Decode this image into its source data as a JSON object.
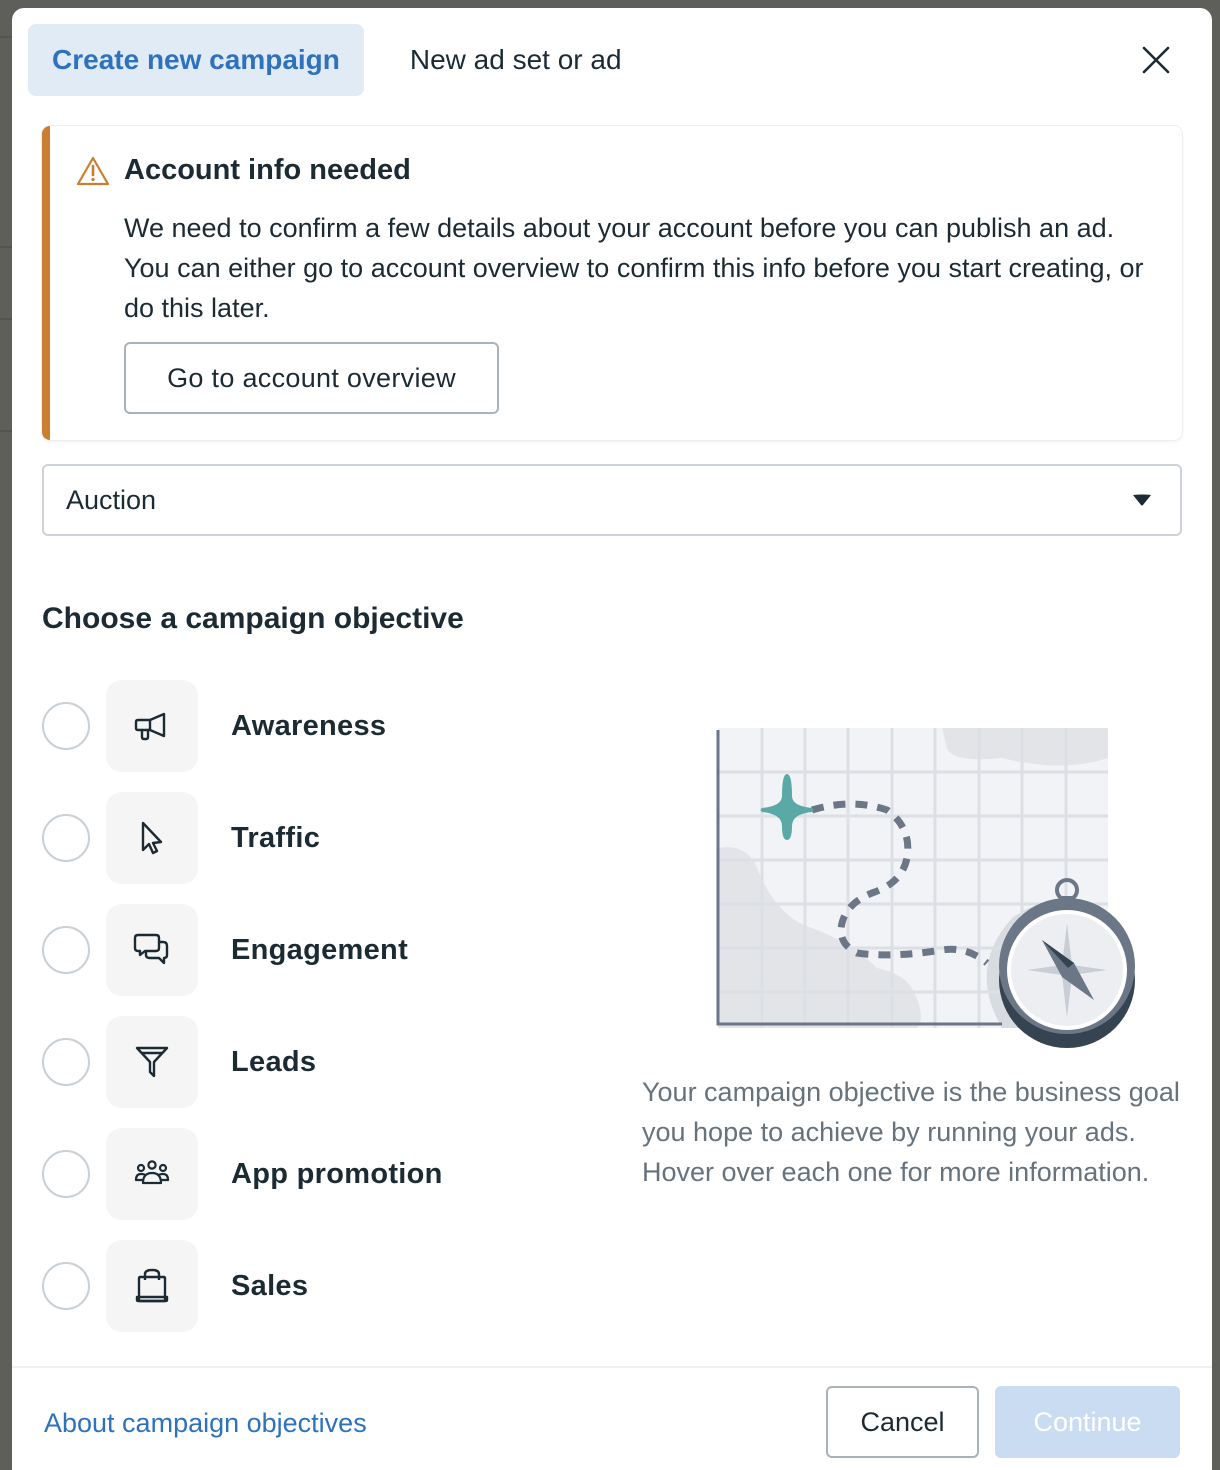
{
  "tabs": [
    {
      "label": "Create new campaign",
      "active": true
    },
    {
      "label": "New ad set or ad",
      "active": false
    }
  ],
  "close_icon": "close-icon",
  "alert": {
    "icon": "warning-triangle-icon",
    "title": "Account info needed",
    "body": "We need to confirm a few details about your account before you can publish an ad. You can either go to account overview to confirm this info before you start creating, or do this later.",
    "button_label": "Go to account overview",
    "accent_color": "#c97f2f"
  },
  "buying_type": {
    "selected": "Auction",
    "icon": "caret-down-icon"
  },
  "objective_section": {
    "title": "Choose a campaign objective",
    "options": [
      {
        "label": "Awareness",
        "icon": "megaphone-icon",
        "selected": false
      },
      {
        "label": "Traffic",
        "icon": "cursor-icon",
        "selected": false
      },
      {
        "label": "Engagement",
        "icon": "chat-bubbles-icon",
        "selected": false
      },
      {
        "label": "Leads",
        "icon": "funnel-icon",
        "selected": false
      },
      {
        "label": "App promotion",
        "icon": "people-group-icon",
        "selected": false
      },
      {
        "label": "Sales",
        "icon": "shopping-bag-icon",
        "selected": false
      }
    ],
    "illustration": "map-compass-illustration",
    "description": "Your campaign objective is the business goal you hope to achieve by running your ads. Hover over each one for more information."
  },
  "footer": {
    "link_label": "About campaign objectives",
    "cancel_label": "Cancel",
    "continue_label": "Continue",
    "continue_enabled": false
  },
  "colors": {
    "primary_blue": "#2e72be",
    "active_tab_bg": "#e1ebf6",
    "disabled_button_bg": "#c9dcf2",
    "text_dark": "#1c2b33",
    "text_muted": "#66727c",
    "illustration_teal": "#5aa9a6"
  }
}
